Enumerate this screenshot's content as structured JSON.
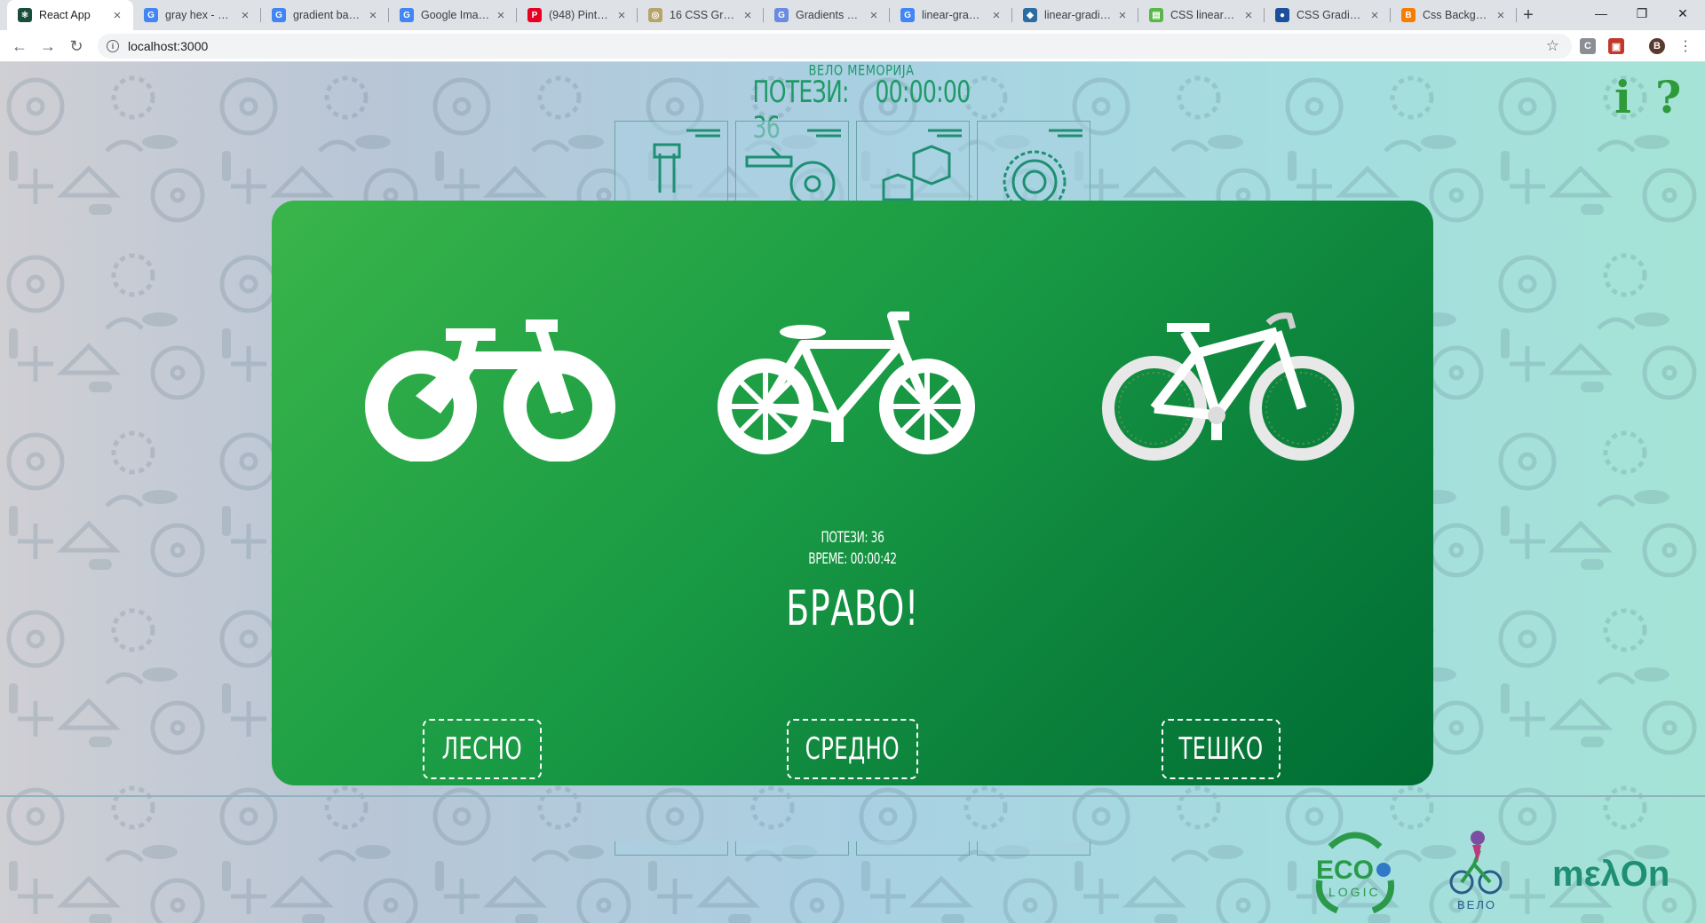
{
  "browser": {
    "tabs": [
      {
        "title": "React App",
        "favicon": "react-favicon",
        "color": "#1b4d3e",
        "glyph": "⚛"
      },
      {
        "title": "gray hex - Goo",
        "favicon": "google-favicon",
        "color": "#4285f4",
        "glyph": "G"
      },
      {
        "title": "gradient backg",
        "favicon": "google-favicon",
        "color": "#4285f4",
        "glyph": "G"
      },
      {
        "title": "Google Images",
        "favicon": "google-favicon",
        "color": "#4285f4",
        "glyph": "G"
      },
      {
        "title": "(948) Pinterest",
        "favicon": "pinterest-favicon",
        "color": "#e60023",
        "glyph": "P"
      },
      {
        "title": "16 CSS Gradie",
        "favicon": "webpage-favicon",
        "color": "#b8a46a",
        "glyph": "◎"
      },
      {
        "title": "Gradients — C",
        "favicon": "webpage-favicon",
        "color": "#6a8be0",
        "glyph": "G"
      },
      {
        "title": "linear-gradien",
        "favicon": "google-favicon",
        "color": "#4285f4",
        "glyph": "G"
      },
      {
        "title": "linear-gradien",
        "favicon": "webpage-favicon",
        "color": "#2b6ca3",
        "glyph": "◆"
      },
      {
        "title": "CSS linear-gra",
        "favicon": "webpage-favicon",
        "color": "#58b847",
        "glyph": "▤"
      },
      {
        "title": "CSS Gradient",
        "favicon": "webpage-favicon",
        "color": "#1c4f9c",
        "glyph": "●"
      },
      {
        "title": "Css Backgroun",
        "favicon": "blogger-favicon",
        "color": "#f57d00",
        "glyph": "B"
      }
    ],
    "url": "localhost:3000",
    "profile_initial": "B"
  },
  "game": {
    "title": "ВЕЛО МЕМОРИЈА",
    "moves_label": "ПОТЕЗИ: 36",
    "timer": "00:00:00",
    "info_icon": "i",
    "help_icon": "?"
  },
  "modal": {
    "bikes": [
      "kids-bike-icon",
      "city-bike-icon",
      "mountain-bike-icon"
    ],
    "moves": "ПОТЕЗИ: 36",
    "time": "ВРЕМЕ: 00:00:42",
    "message": "БРАВО!",
    "levels": [
      {
        "label": "ЛЕСНО"
      },
      {
        "label": "СРЕДНО"
      },
      {
        "label": "ТЕШКО"
      }
    ]
  },
  "footer": {
    "eco_top": "ECO",
    "eco_bottom": "LOGIC",
    "velo": "ВЕЛО",
    "melon": "mελOn"
  },
  "colors": {
    "modal_green": "#1e9e45",
    "title_green": "#1e9a68",
    "icon_green": "#2e9a3a"
  }
}
